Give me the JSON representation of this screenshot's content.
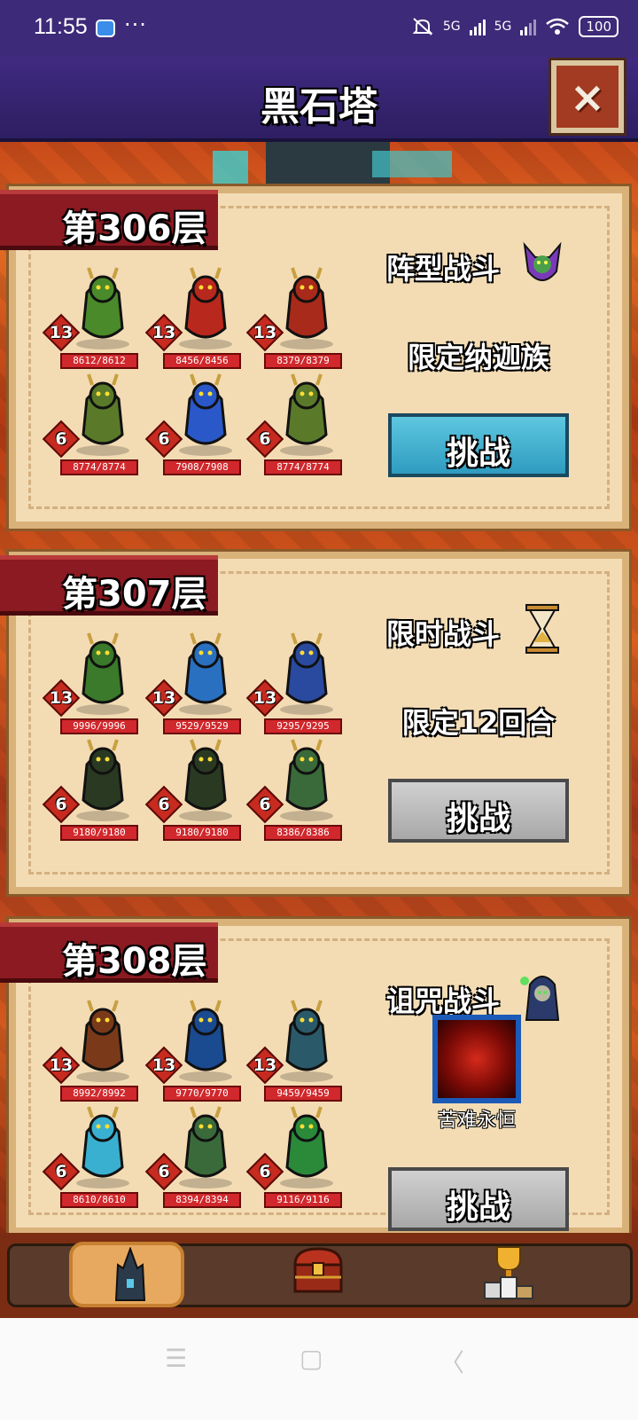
{
  "status_bar": {
    "time": "11:55",
    "dots": "···",
    "net1": "5G",
    "net2": "5G",
    "battery": "100"
  },
  "header": {
    "title": "黑石塔",
    "close_icon": "×"
  },
  "floors": [
    {
      "label": "第306层",
      "battle_type": "阵型战斗",
      "restriction": "限定纳迦族",
      "challenge_label": "挑战",
      "challenge_state": "active",
      "monsters": [
        {
          "level": "13",
          "hp": "8612/8612",
          "color": "#4a8a2a"
        },
        {
          "level": "13",
          "hp": "8456/8456",
          "color": "#b8281c"
        },
        {
          "level": "13",
          "hp": "8379/8379",
          "color": "#a82a1a"
        },
        {
          "level": "6",
          "hp": "8774/8774",
          "color": "#5a7a2a"
        },
        {
          "level": "6",
          "hp": "7908/7908",
          "color": "#2a58c8"
        },
        {
          "level": "6",
          "hp": "8774/8774",
          "color": "#5a7a2a"
        }
      ]
    },
    {
      "label": "第307层",
      "battle_type": "限时战斗",
      "restriction": "限定12回合",
      "challenge_label": "挑战",
      "challenge_state": "disabled",
      "monsters": [
        {
          "level": "13",
          "hp": "9996/9996",
          "color": "#3a7a2a"
        },
        {
          "level": "13",
          "hp": "9529/9529",
          "color": "#2a70c0"
        },
        {
          "level": "13",
          "hp": "9295/9295",
          "color": "#2a4aa0"
        },
        {
          "level": "6",
          "hp": "9180/9180",
          "color": "#2a3a22"
        },
        {
          "level": "6",
          "hp": "9180/9180",
          "color": "#2a3a22"
        },
        {
          "level": "6",
          "hp": "8386/8386",
          "color": "#3a6a3a"
        }
      ]
    },
    {
      "label": "第308层",
      "battle_type": "诅咒战斗",
      "restriction": "",
      "curse_name": "苦难永恒",
      "challenge_label": "挑战",
      "challenge_state": "disabled",
      "monsters": [
        {
          "level": "13",
          "hp": "8992/8992",
          "color": "#7a3a1a"
        },
        {
          "level": "13",
          "hp": "9770/9770",
          "color": "#1a4a90"
        },
        {
          "level": "13",
          "hp": "9459/9459",
          "color": "#2a5a6a"
        },
        {
          "level": "6",
          "hp": "8610/8610",
          "color": "#3ab0d0"
        },
        {
          "level": "6",
          "hp": "8394/8394",
          "color": "#3a6a3a"
        },
        {
          "level": "6",
          "hp": "9116/9116",
          "color": "#2a8a3a"
        }
      ]
    }
  ],
  "tabs": [
    {
      "name": "tower-tab",
      "icon": "tower-icon",
      "selected": true
    },
    {
      "name": "chest-tab",
      "icon": "treasure-chest-icon",
      "selected": false
    },
    {
      "name": "ranking-tab",
      "icon": "trophy-podium-icon",
      "selected": false
    }
  ],
  "colors": {
    "header_bg": "#3f2a80",
    "panel_bg": "#f3dcb4",
    "floor_label_bg": "#8b1a22",
    "challenge_active": "#2f9bc0",
    "challenge_disabled": "#a8a8a8",
    "level_badge": "#c72b1f",
    "hp_bar": "#d0282c"
  }
}
